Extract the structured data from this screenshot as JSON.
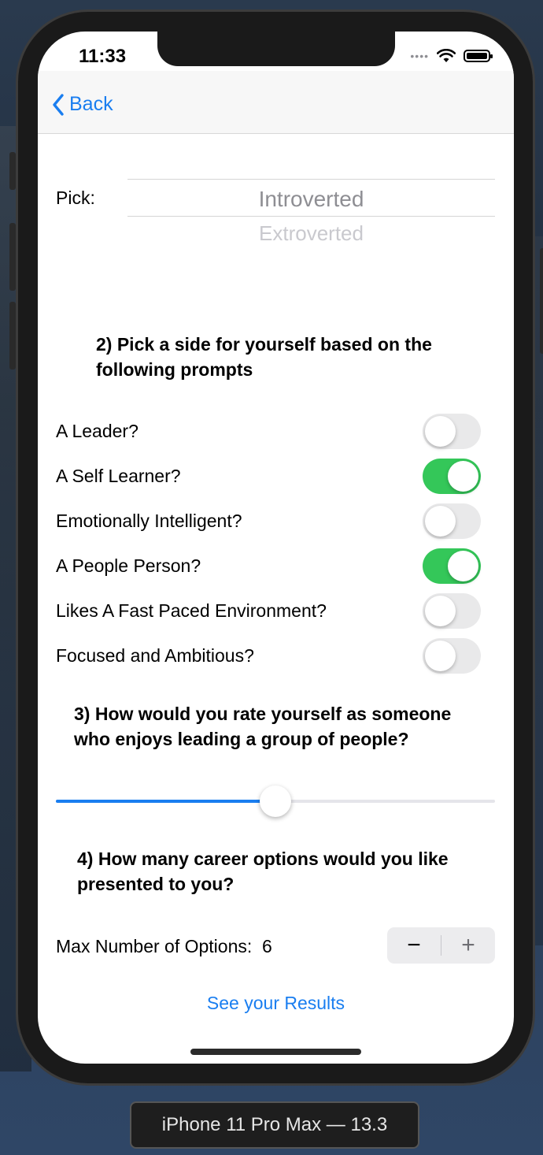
{
  "status": {
    "time": "11:33"
  },
  "nav": {
    "back_label": "Back"
  },
  "picker": {
    "label": "Pick:",
    "selected": "Introverted",
    "next": "Extroverted"
  },
  "question2": {
    "heading_line1": "2) Pick a side for yourself based on the",
    "heading_line2": "following prompts"
  },
  "toggles": [
    {
      "label": "A Leader?",
      "on": false
    },
    {
      "label": "A Self Learner?",
      "on": true
    },
    {
      "label": "Emotionally Intelligent?",
      "on": false
    },
    {
      "label": "A People Person?",
      "on": true
    },
    {
      "label": "Likes A Fast Paced Environment?",
      "on": false
    },
    {
      "label": "Focused and Ambitious?",
      "on": false
    }
  ],
  "question3": {
    "heading_line1": "3) How would you rate yourself as someone",
    "heading_line2": "who enjoys leading a group of people?"
  },
  "slider": {
    "value_fraction": 0.5
  },
  "question4": {
    "heading_line1": "4) How many career options would you like",
    "heading_line2": "presented to you?"
  },
  "stepper": {
    "label": "Max Number of Options:",
    "value": "6",
    "minus": "−",
    "plus": "+"
  },
  "results_label": "See your Results",
  "device_label": "iPhone 11 Pro Max — 13.3",
  "colors": {
    "accent": "#1a7ef0",
    "switch_on": "#34c759"
  }
}
